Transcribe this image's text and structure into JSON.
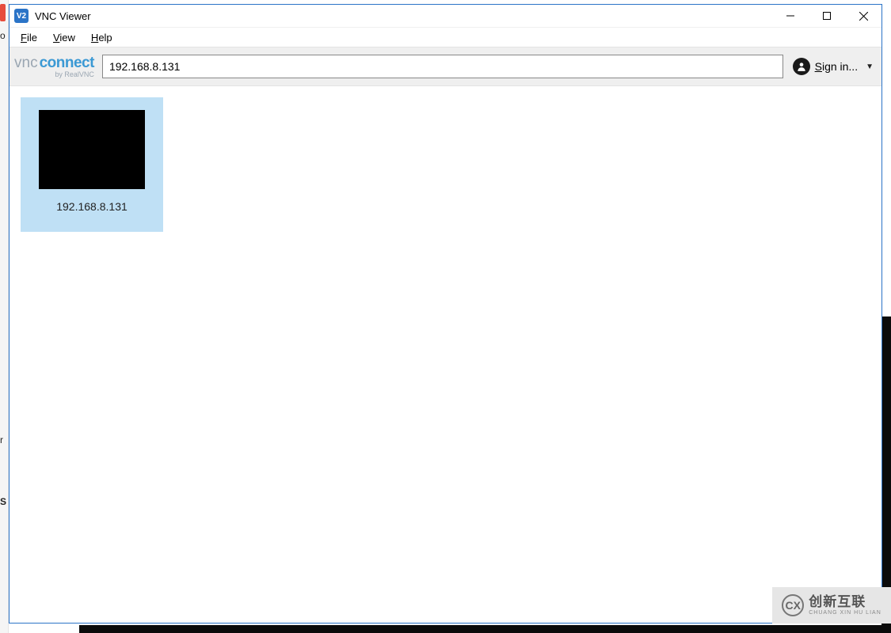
{
  "window": {
    "title": "VNC Viewer",
    "app_icon_label": "V2"
  },
  "menu": {
    "file": "File",
    "view": "View",
    "help": "Help"
  },
  "toolbar": {
    "logo_vnc": "vnc",
    "logo_connect": "connect",
    "logo_subtitle": "by RealVNC",
    "address_value": "192.168.8.131",
    "signin_label": "Sign in..."
  },
  "connections": [
    {
      "label": "192.168.8.131"
    }
  ],
  "background": {
    "left_fragment_1": "o",
    "left_fragment_2": "r",
    "left_fragment_3": "S"
  },
  "watermark": {
    "text_main": "创新互联",
    "text_sub": "CHUANG XIN HU LIAN"
  }
}
